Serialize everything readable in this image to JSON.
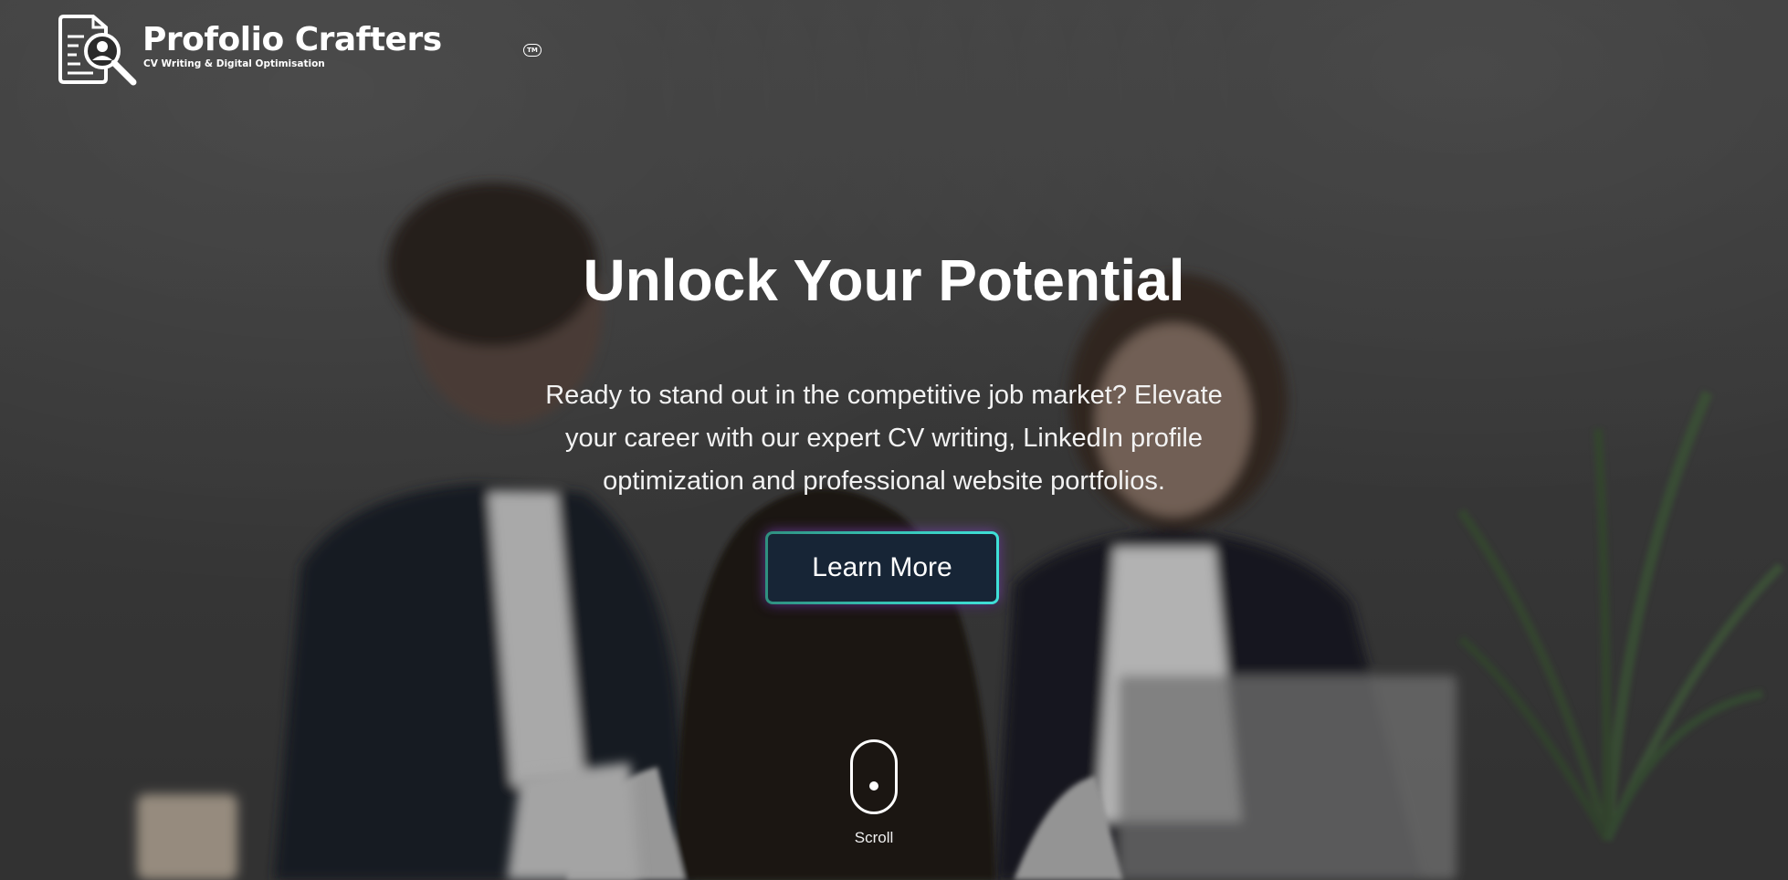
{
  "brand": {
    "name": "Profolio Crafters",
    "trademark": "TM",
    "tagline": "CV Writing & Digital Optimisation"
  },
  "hero": {
    "headline": "Unlock Your Potential",
    "subtext": "Ready to stand out in the competitive job market? Elevate your career with our expert CV writing, LinkedIn profile optimization and professional website portfolios.",
    "cta_label": "Learn More",
    "scroll_label": "Scroll"
  },
  "colors": {
    "cta_background": "#172536",
    "cta_border_start": "#2f8f7f",
    "cta_border_end": "#3fe0d8",
    "text": "#ffffff"
  },
  "icons": {
    "logo": "resume-search-icon",
    "scroll": "mouse-scroll-icon"
  }
}
